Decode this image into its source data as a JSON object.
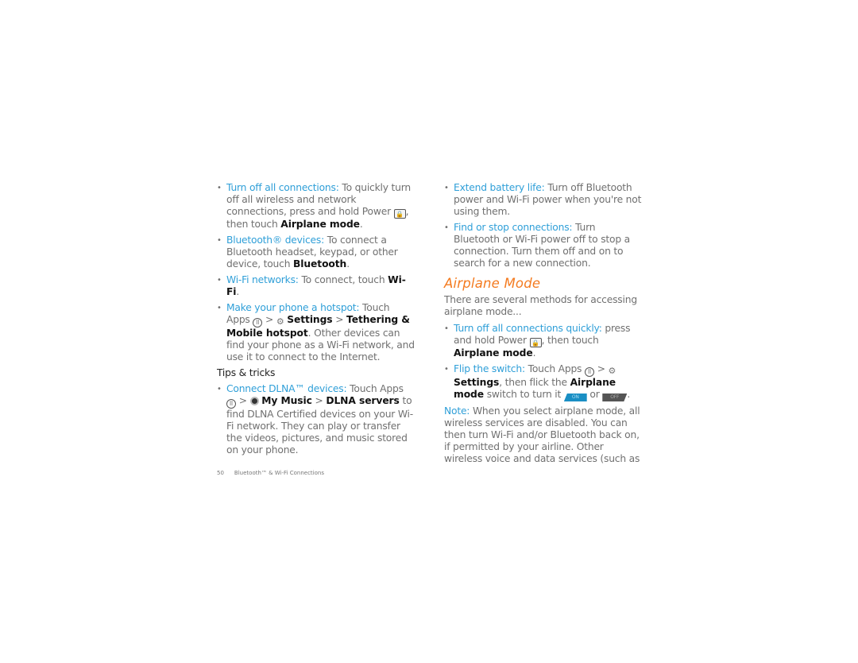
{
  "left": {
    "items": [
      {
        "lead": "Turn off all connections:",
        "t1": " To quickly turn off all wireless and network connections, press and hold Power ",
        "icon": "power-key-icon",
        "t2": ", then touch ",
        "bold": "Airplane mode",
        "t3": "."
      },
      {
        "lead": "Bluetooth® devices:",
        "t1": " To connect a Bluetooth headset, keypad, or other device, touch ",
        "bold": "Bluetooth",
        "t2": "."
      },
      {
        "lead": "Wi-Fi networks:",
        "t1": " To connect, touch ",
        "bold": "Wi-Fi",
        "t2": "."
      },
      {
        "lead": "Make your phone a hotspot:",
        "t1": " Touch Apps ",
        "sep1": " > ",
        "bold1": "Settings",
        "sep2": " > ",
        "bold2": "Tethering & Mobile hotspot",
        "t2": ". Other devices can find your phone as a Wi-Fi network, and use it to connect to the Internet."
      }
    ],
    "subheading": "Tips & tricks",
    "tips": [
      {
        "lead": "Connect DLNA™ devices:",
        "t1": " Touch Apps ",
        "sep1": " > ",
        "bold1": "My Music",
        "sep2": " > ",
        "bold2": "DLNA servers",
        "t2": " to find DLNA Certified devices on your Wi-Fi network. They can play or transfer the videos, pictures, and music stored on your phone."
      }
    ]
  },
  "right": {
    "items": [
      {
        "lead": "Extend battery life:",
        "t1": " Turn off Bluetooth power and Wi-Fi power when you're not using them."
      },
      {
        "lead": "Find or stop connections:",
        "t1": " Turn Bluetooth or Wi-Fi power off to stop a connection. Turn them off and on to search for a new connection."
      }
    ],
    "heading": "Airplane Mode",
    "intro": "There are several methods for accessing airplane mode...",
    "methods": [
      {
        "lead": "Turn off all connections quickly:",
        "t1": " press and hold Power ",
        "t2": ", then touch ",
        "bold": "Airplane mode",
        "t3": "."
      },
      {
        "lead": "Flip the switch:",
        "t1": " Touch Apps ",
        "sep1": " > ",
        "bold1": "Settings",
        "t2": ", then flick the ",
        "bold2": "Airplane mode",
        "t3": " switch to turn it ",
        "on": "ON",
        "or": " or ",
        "off": "OFF",
        "t4": "."
      }
    ],
    "note_lead": "Note:",
    "note": " When you select airplane mode, all wireless services are disabled. You can then turn Wi-Fi and/or Bluetooth back on, if permitted by your airline. Other wireless voice and data services (such as"
  },
  "footer": {
    "page": "50",
    "section": "Bluetooth™ & Wi-Fi Connections"
  },
  "icons": {
    "power": "🔒⏻",
    "apps": "⠿",
    "gear": "⚙"
  },
  "colors": {
    "accent": "#2f9fd8",
    "heading": "#f47b20",
    "body": "#707070"
  }
}
